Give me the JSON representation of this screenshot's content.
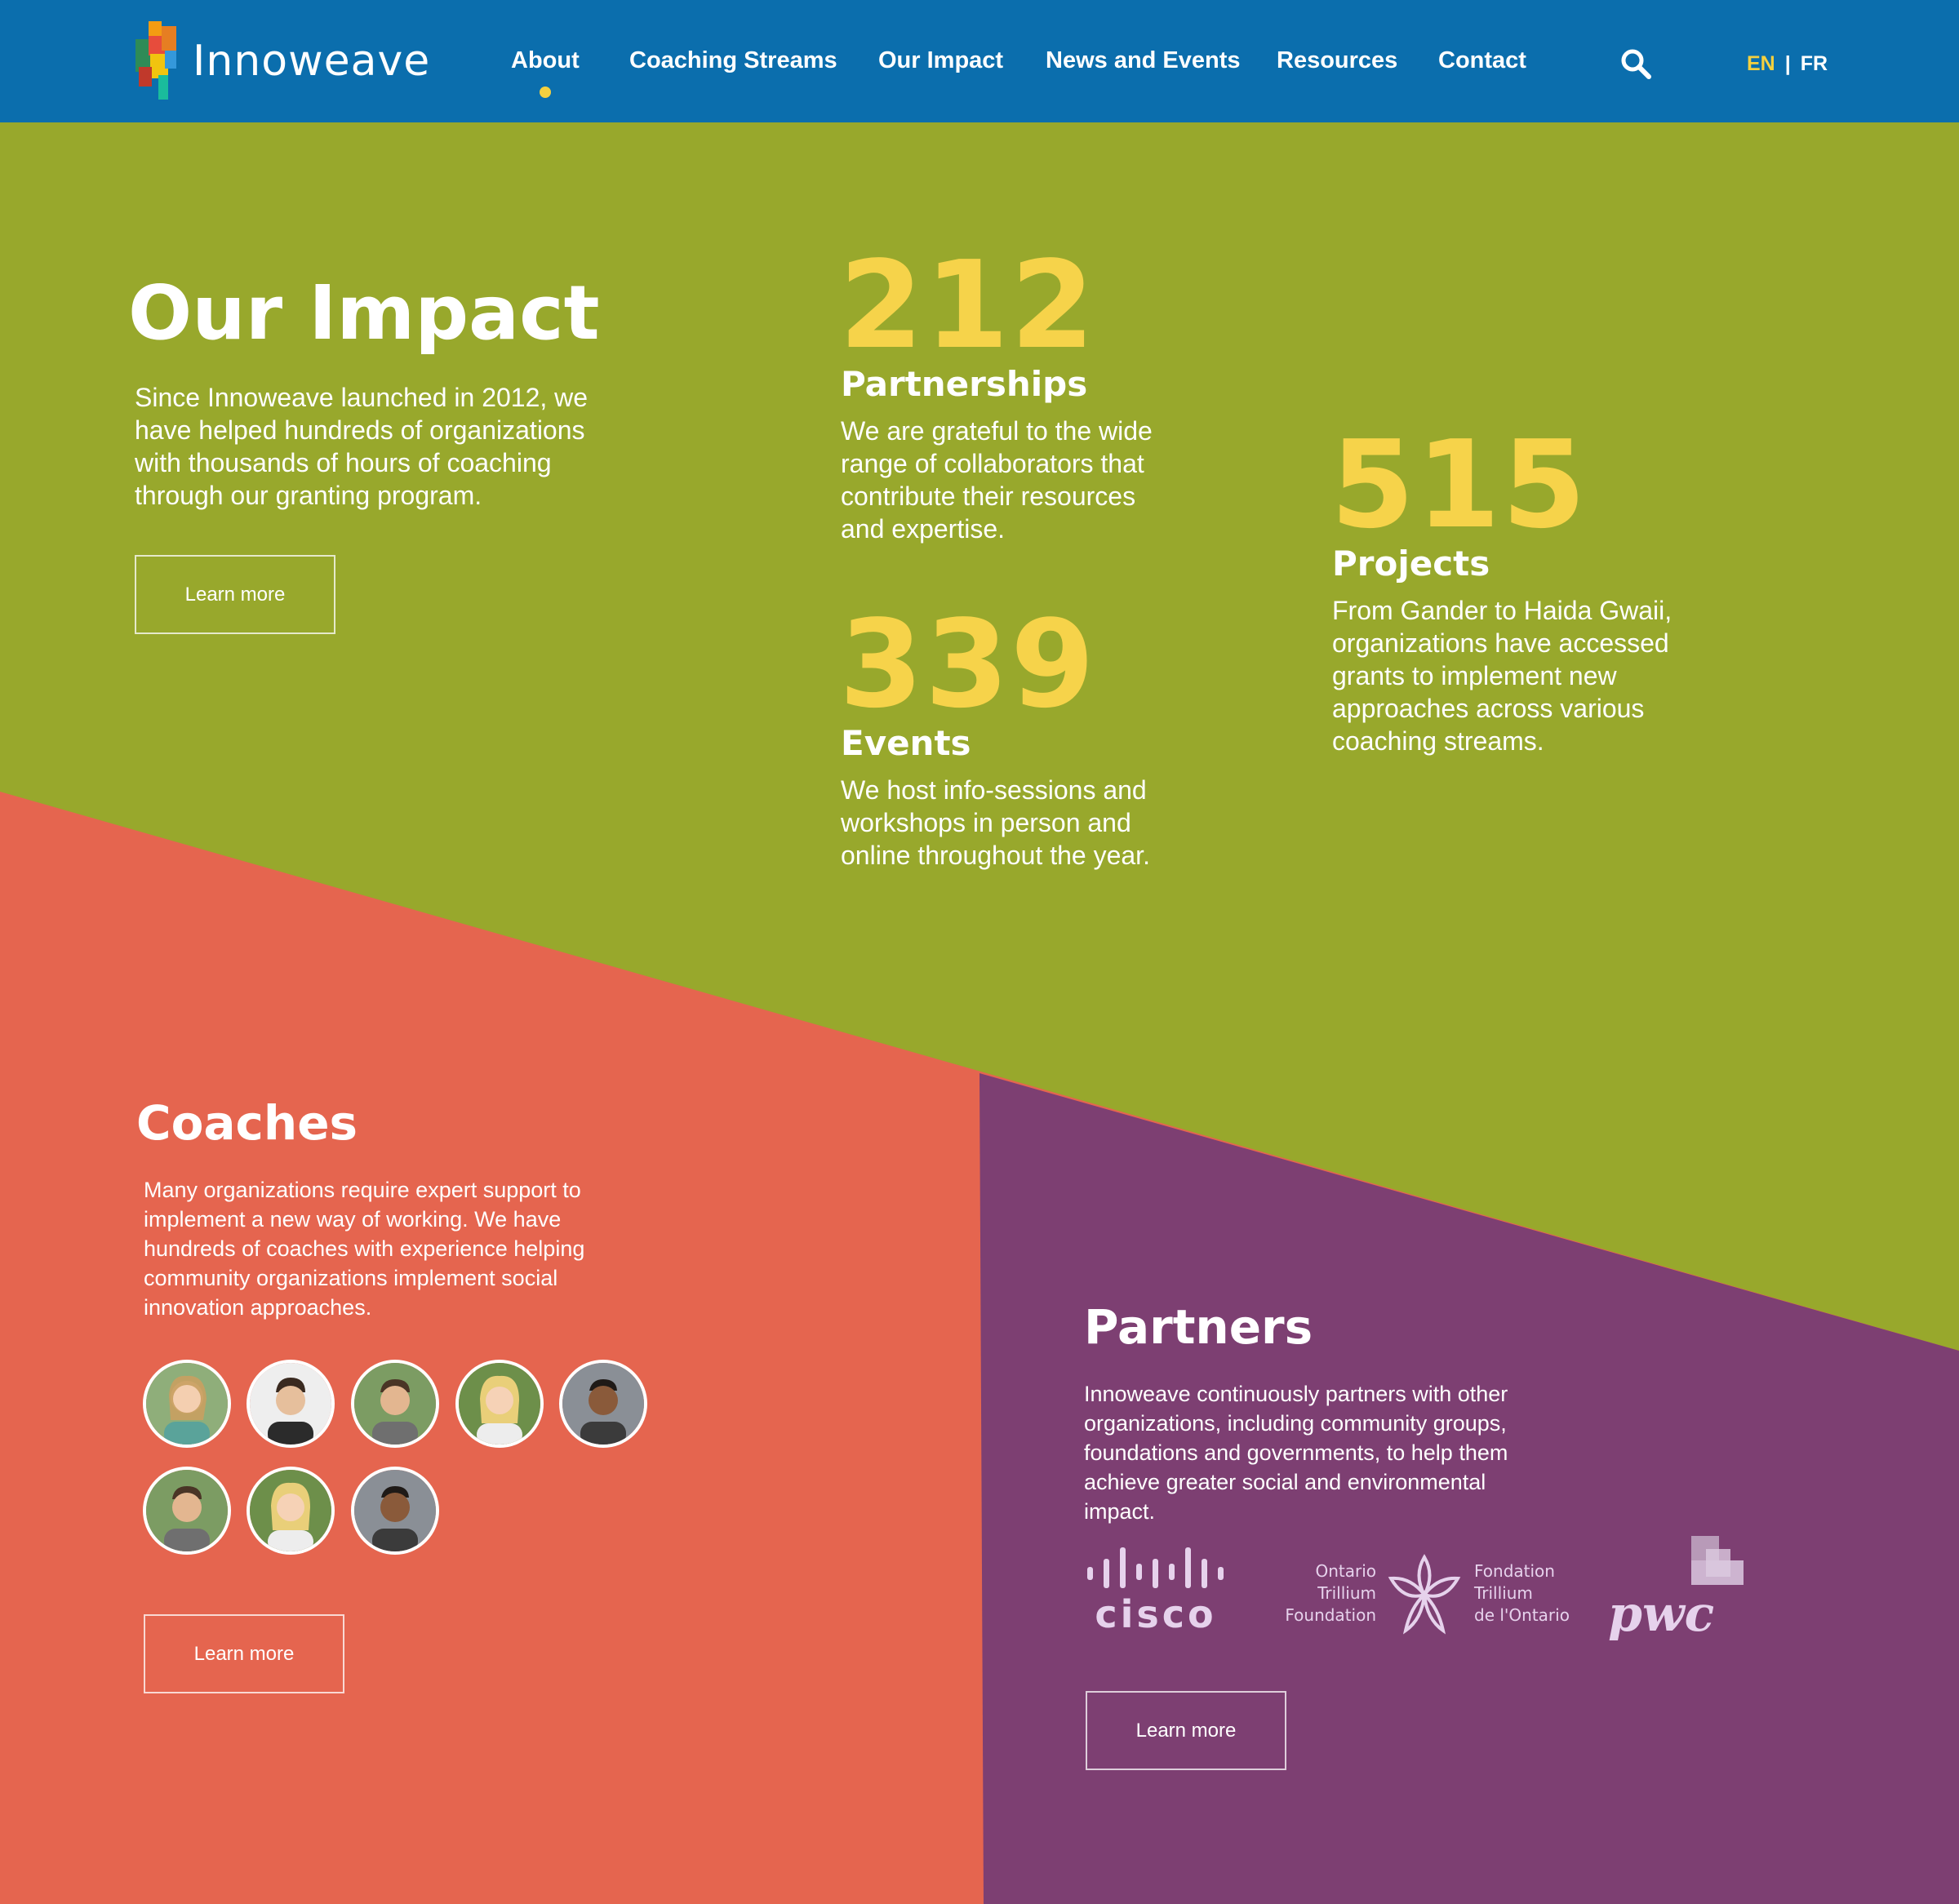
{
  "colors": {
    "header": "#0b6ead",
    "green": "#98a82c",
    "coral": "#e5654f",
    "purple": "#7d3f72",
    "accent_yellow": "#f6d34a"
  },
  "header": {
    "logo_text": "Innoweave",
    "nav": [
      {
        "label": "About",
        "active": true
      },
      {
        "label": "Coaching Streams",
        "active": false
      },
      {
        "label": "Our Impact",
        "active": false
      },
      {
        "label": "News and Events",
        "active": false
      },
      {
        "label": "Resources",
        "active": false
      },
      {
        "label": "Contact",
        "active": false
      }
    ],
    "search_icon": "search-icon",
    "lang": {
      "en": "EN",
      "separator": "|",
      "fr": "FR"
    }
  },
  "impact": {
    "title": "Our Impact",
    "text": "Since Innoweave launched in 2012, we have helped hundreds of organizations with thousands of hours of coaching through our granting program.",
    "button": "Learn more",
    "stats": [
      {
        "number": "212",
        "label": "Partnerships",
        "text": "We are grateful to the wide range of collaborators that contribute their resources and expertise."
      },
      {
        "number": "339",
        "label": "Events",
        "text": "We host info-sessions and workshops in person and online throughout the year."
      },
      {
        "number": "515",
        "label": "Projects",
        "text": "From Gander to Haida Gwaii, organizations have accessed grants to implement new approaches across various coaching streams."
      }
    ]
  },
  "coaches": {
    "title": "Coaches",
    "text": "Many organizations require expert support to implement a new way of working. We have hundreds of coaches with experience helping community organizations implement social innovation approaches.",
    "button": "Learn more",
    "avatars": [
      "avatar-1",
      "avatar-2",
      "avatar-3",
      "avatar-4",
      "avatar-5",
      "avatar-6",
      "avatar-7",
      "avatar-8"
    ]
  },
  "partners": {
    "title": "Partners",
    "text": "Innoweave continuously partners with other organizations, including community groups, foundations and governments, to help them achieve greater social and environmental impact.",
    "button": "Learn more",
    "logos": {
      "cisco": "cisco",
      "trillium_en": [
        "Ontario",
        "Trillium",
        "Foundation"
      ],
      "trillium_fr": [
        "Fondation",
        "Trillium",
        "de l'Ontario"
      ],
      "pwc": "pwc"
    }
  }
}
